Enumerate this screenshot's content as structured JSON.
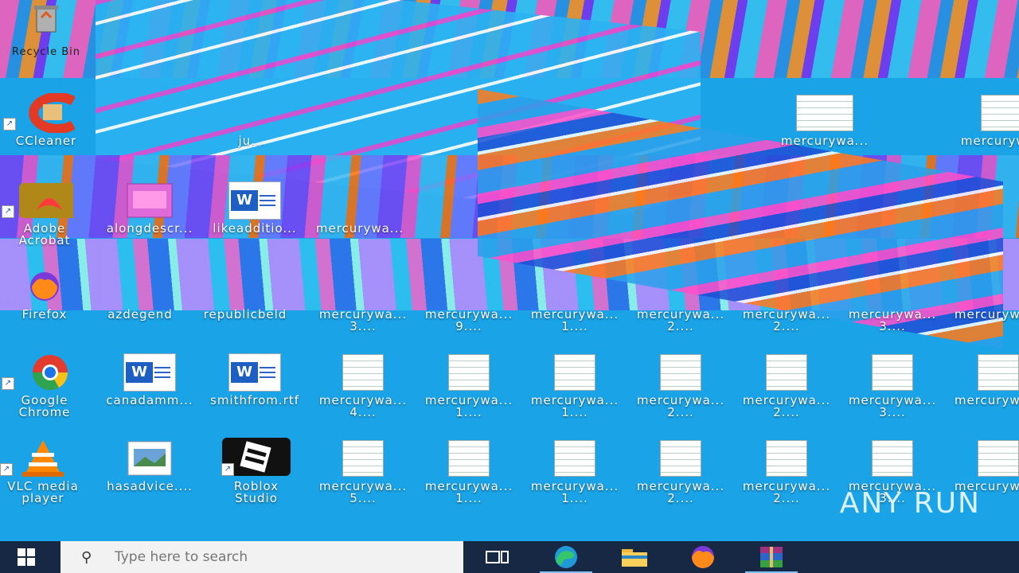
{
  "desktop": {
    "row0": [
      {
        "label": "Recycle Bin",
        "icon": "recycle-bin-icon"
      }
    ],
    "row1": [
      {
        "label": "CCleaner",
        "icon": "ccleaner-icon"
      },
      {
        "label": "ju...",
        "icon": "shortcut-icon"
      },
      {
        "label": "mercurywa...",
        "icon": "document-icon"
      },
      {
        "label": "mercurywa...",
        "icon": "document-icon"
      }
    ],
    "row2": [
      {
        "label": "Adobe\nAcrobat",
        "icon": "acrobat-icon"
      },
      {
        "label": "alongdescr...",
        "icon": "image-file-icon"
      },
      {
        "label": "likeadditio...",
        "icon": "word-doc-icon"
      },
      {
        "label": "mercurywa...",
        "icon": "document-icon"
      }
    ],
    "row3": [
      {
        "label": "Firefox",
        "icon": "firefox-icon"
      },
      {
        "label": "azdegend",
        "icon": "document-icon"
      },
      {
        "label": "republicbeld",
        "icon": "document-icon"
      },
      {
        "label": "mercurywa...\n3....",
        "icon": "document-icon"
      },
      {
        "label": "mercurywa...\n9....",
        "icon": "document-icon"
      },
      {
        "label": "mercurywa...\n1....",
        "icon": "document-icon"
      },
      {
        "label": "mercurywa...\n2....",
        "icon": "document-icon"
      },
      {
        "label": "mercurywa...\n2....",
        "icon": "document-icon"
      },
      {
        "label": "mercurywa...\n3....",
        "icon": "document-icon"
      },
      {
        "label": "mercurywa...",
        "icon": "document-icon"
      }
    ],
    "row4": [
      {
        "label": "Google\nChrome",
        "icon": "chrome-icon"
      },
      {
        "label": "canadamm...",
        "icon": "word-doc-icon"
      },
      {
        "label": "smithfrom.rtf",
        "icon": "word-doc-icon"
      },
      {
        "label": "mercurywa...\n4....",
        "icon": "document-icon"
      },
      {
        "label": "mercurywa...\n1....",
        "icon": "document-icon"
      },
      {
        "label": "mercurywa...\n1....",
        "icon": "document-icon"
      },
      {
        "label": "mercurywa...\n2....",
        "icon": "document-icon"
      },
      {
        "label": "mercurywa...\n2....",
        "icon": "document-icon"
      },
      {
        "label": "mercurywa...\n3....",
        "icon": "document-icon"
      },
      {
        "label": "mercurywa...",
        "icon": "document-icon"
      }
    ],
    "row5": [
      {
        "label": "VLC media\nplayer",
        "icon": "vlc-icon"
      },
      {
        "label": "hasadvice....",
        "icon": "image-file-icon"
      },
      {
        "label": "Roblox\nStudio",
        "icon": "roblox-studio-icon"
      },
      {
        "label": "mercurywa...\n5....",
        "icon": "document-icon"
      },
      {
        "label": "mercurywa...\n1....",
        "icon": "document-icon"
      },
      {
        "label": "mercurywa...\n1....",
        "icon": "document-icon"
      },
      {
        "label": "mercurywa...\n2....",
        "icon": "document-icon"
      },
      {
        "label": "mercurywa...\n2....",
        "icon": "document-icon"
      },
      {
        "label": "mercurywa...\n3....",
        "icon": "document-icon"
      },
      {
        "label": "mercurywa...",
        "icon": "document-icon"
      }
    ]
  },
  "taskbar": {
    "search_placeholder": "Type here to search",
    "buttons": [
      {
        "name": "task-view",
        "icon": "task-view-icon"
      },
      {
        "name": "edge",
        "icon": "edge-icon"
      },
      {
        "name": "file-explorer",
        "icon": "folder-icon"
      },
      {
        "name": "firefox",
        "icon": "firefox-icon"
      },
      {
        "name": "winrar",
        "icon": "winrar-icon"
      }
    ]
  },
  "watermark": "ANY RUN"
}
